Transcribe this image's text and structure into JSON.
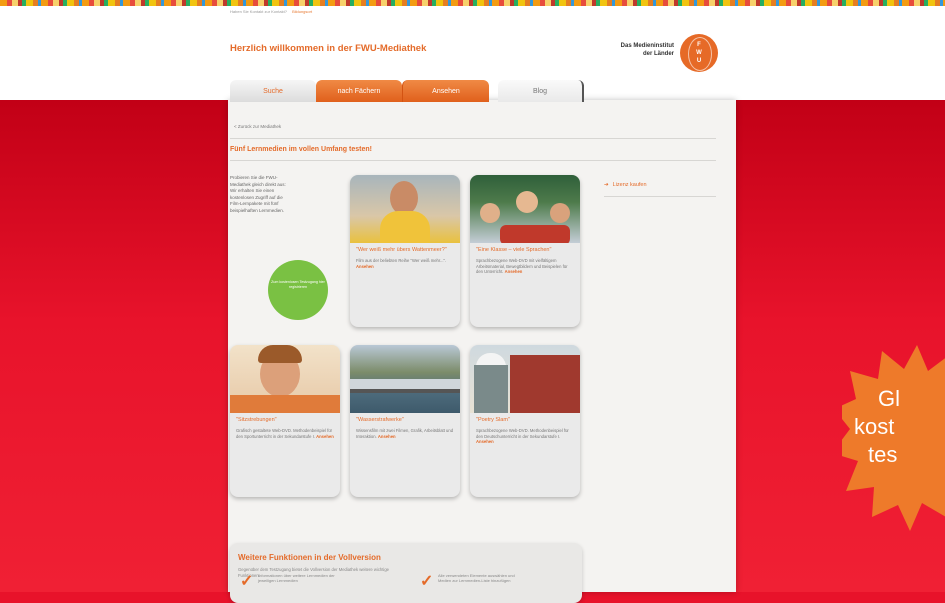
{
  "header": {
    "top_links": [
      "Haben Sie Kontakt zur Kontakt?",
      "Bildungsort"
    ],
    "site_title": "Herzlich willkommen in der FWU-Mediathek",
    "logo_text_line1": "Das Medieninstitut",
    "logo_text_line2": "der Länder",
    "logo_letters": "F W U"
  },
  "tabs": [
    {
      "label": "Suche"
    },
    {
      "label": "nach Fächern"
    },
    {
      "label": "Ansehen"
    },
    {
      "label": "Blog"
    }
  ],
  "breadcrumb": "< Zurück zur Mediathek",
  "section_title": "Fünf Lernmedien im vollen Umfang testen!",
  "intro_text": "Probieren Sie die FWU-Mediathek gleich direkt aus: Wir erhalten Sie einen kostenlosen Zugriff auf die Film-Lernpakete mit fünf beispielhaften Lernmedien.",
  "badge_text": "Zum kostenlosen Testzugang hier registrieren",
  "cards": [
    {
      "title": "\"Wer weiß mehr übers Wattenmeer?\"",
      "desc": "Film aus der beliebten Reihe \"Wer weiß mehr...\".",
      "more": "Ansehen"
    },
    {
      "title": "\"Eine Klasse – viele Sprachen\"",
      "desc": "Sprachbezogene Web-DVD mit vielfältigem Arbeitsmaterial, Bewegtbildern und Beispielen für den Unterricht.",
      "more": "Ansehen"
    },
    {
      "title": "\"Sitzstrebungen\"",
      "desc": "Grafisch gestaltete Web-DVD. Methodenbeispiel für den Sportunterricht in der Sekundarstufe I.",
      "more": "Ansehen"
    },
    {
      "title": "\"Wasserstrafwerke\"",
      "desc": "Wissensfilm mit zwei Filmen, Grafik, Arbeitsblatt und Interaktion.",
      "more": "Ansehen"
    },
    {
      "title": "\"Poetry Slam\"",
      "desc": "Sprachbezogene Web-DVD. Methodenbeispiel für den Deutschunterricht in der Sekundarstufe I.",
      "more": "Ansehen"
    }
  ],
  "side_link": "Lizenz kaufen",
  "features": {
    "title": "Weitere Funktionen in der Vollversion",
    "subtitle": "Gegenüber dem Testzugang bietet die Vollversion der Mediathek weitere wichtige Funktionen:",
    "items": [
      "Informationen über weitere Lernmedien der jeweiligen Lernmedien",
      "Alle verwendeten Elemente auswählen und Medien zur Lernmedien-Liste hinzufügen"
    ]
  },
  "promo_star": {
    "line1": "Gl",
    "line2": "kost",
    "line3": "tes"
  },
  "colors": {
    "accent": "#e46b2a",
    "background_red": "#e8122a",
    "badge_green": "#7ac143"
  }
}
